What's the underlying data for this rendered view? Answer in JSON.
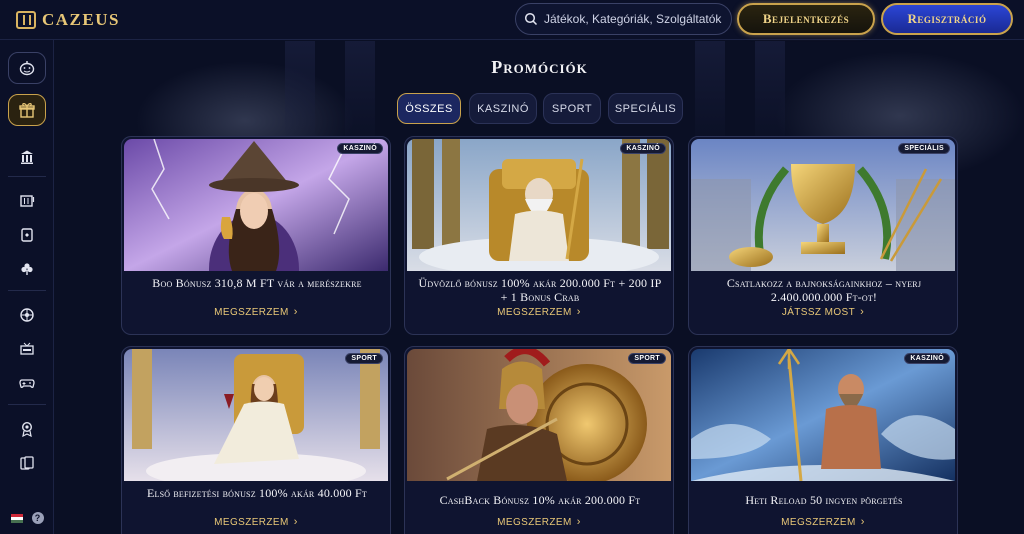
{
  "header": {
    "logo_text": "CAZEUS",
    "search_placeholder": "Játékok, Kategóriák, Szolgáltatók",
    "login_label": "Bejelentkezés",
    "register_label": "Regisztráció"
  },
  "sidebar": {
    "icons": [
      "halloween-pumpkin-icon",
      "gift-icon",
      "temple-icon",
      "slot-machine-icon",
      "playing-card-icon",
      "clover-icon",
      "roulette-icon",
      "live-tv-icon",
      "gamepad-icon",
      "trophy-award-icon",
      "cards-icon"
    ],
    "language_flag": "hu",
    "help_glyph": "?"
  },
  "main": {
    "title": "Promóciók",
    "tabs": [
      {
        "label": "ÖSSZES",
        "active": true
      },
      {
        "label": "KASZINÓ",
        "active": false
      },
      {
        "label": "SPORT",
        "active": false
      },
      {
        "label": "SPECIÁLIS",
        "active": false
      }
    ],
    "promos": [
      {
        "badge": "KASZINÓ",
        "title": "Boo Bónusz 310,8 M FT vár a merészekre",
        "cta": "MEGSZERZEM",
        "image": "witch-with-goblet-lightning"
      },
      {
        "badge": "KASZINÓ",
        "title": "Üdvözlő bónusz 100% akár 200.000 Ft + 200 IP + 1 Bonus Crab",
        "cta": "MEGSZERZEM",
        "image": "zeus-on-golden-throne"
      },
      {
        "badge": "SPECIÁLIS",
        "title": "Csatlakozz a bajnokságainkhoz – nyerj 2.400.000.000 Ft-ot!",
        "cta": "JÁTSSZ MOST",
        "image": "golden-trophy-spears"
      },
      {
        "badge": "SPORT",
        "title": "Első befizetési bónusz 100% akár 40.000 Ft",
        "cta": "MEGSZERZEM",
        "image": "goddess-on-throne-wine"
      },
      {
        "badge": "SPORT",
        "title": "CashBack Bónusz 10% akár 200.000 Ft",
        "cta": "MEGSZERZEM",
        "image": "spartan-warrior-shield"
      },
      {
        "badge": "KASZINÓ",
        "title": "Heti Reload 50 ingyen pörgetés",
        "cta": "MEGSZERZEM",
        "image": "poseidon-with-trident"
      }
    ]
  },
  "colors": {
    "gold": "#e8c777",
    "navy": "#0a0f24",
    "accent_blue": "#2b46d6"
  }
}
